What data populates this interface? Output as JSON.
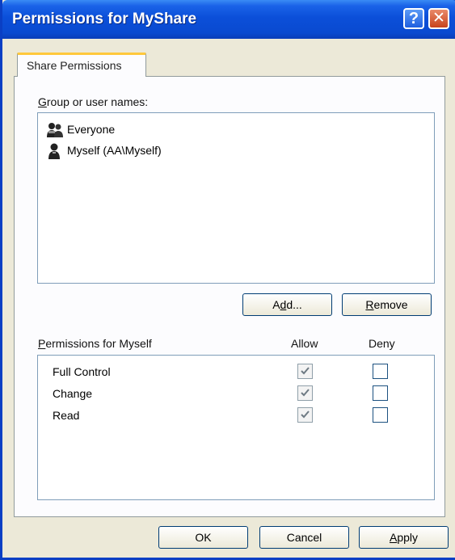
{
  "window": {
    "title": "Permissions for MyShare",
    "help_label": "?",
    "close_label": "✕"
  },
  "tabs": [
    {
      "label": "Share Permissions"
    }
  ],
  "groups": {
    "label_prefix": "",
    "label_underlined": "G",
    "label_rest": "roup or user names:",
    "items": [
      {
        "name": "Everyone",
        "icon": "group-users-icon"
      },
      {
        "name": "Myself (AA\\Myself)",
        "icon": "user-icon"
      }
    ]
  },
  "buttons": {
    "add": {
      "pre": "A",
      "ul": "d",
      "post": "d..."
    },
    "remove": {
      "pre": "",
      "ul": "R",
      "post": "emove"
    }
  },
  "permissions": {
    "title_underlined": "P",
    "title_rest": "ermissions for Myself",
    "allow_header": "Allow",
    "deny_header": "Deny",
    "rows": [
      {
        "name": "Full Control",
        "allow": true,
        "deny": false
      },
      {
        "name": "Change",
        "allow": true,
        "deny": false
      },
      {
        "name": "Read",
        "allow": true,
        "deny": false
      }
    ]
  },
  "footer": {
    "ok": "OK",
    "cancel": "Cancel",
    "apply_underlined": "A",
    "apply_rest": "pply"
  },
  "colors": {
    "title_bar": "#0a4ad0",
    "dialog_bg": "#ece9d8",
    "tab_highlight": "#ffc83c"
  }
}
